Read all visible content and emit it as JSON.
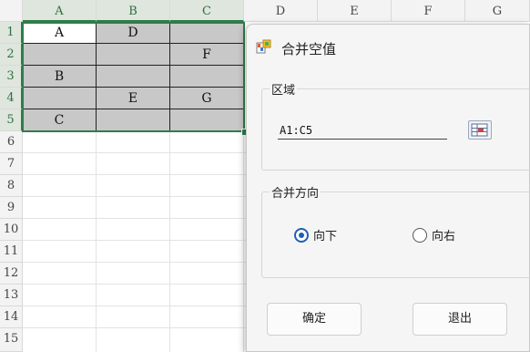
{
  "sheet": {
    "columns": [
      "A",
      "B",
      "C",
      "D",
      "E",
      "F",
      "G"
    ],
    "rows": [
      "1",
      "2",
      "3",
      "4",
      "5",
      "6",
      "7",
      "8",
      "9",
      "10",
      "11",
      "12",
      "13",
      "14",
      "15"
    ],
    "cells": {
      "A1": "A",
      "B1": "D",
      "C1": "",
      "A2": "",
      "B2": "",
      "C2": "F",
      "A3": "B",
      "B3": "",
      "C3": "",
      "A4": "",
      "B4": "E",
      "C4": "G",
      "A5": "C",
      "B5": "",
      "C5": ""
    },
    "selected_range_color": "#2f7d4a",
    "empty_cell_color": "#c8c8c8"
  },
  "dialog": {
    "title": "合并空值",
    "icon": "merge-table-icon",
    "region": {
      "label": "区域",
      "value": "A1:C5",
      "picker_icon": "range-select-icon"
    },
    "direction": {
      "label": "合并方向",
      "options": [
        {
          "label": "向下",
          "selected": true
        },
        {
          "label": "向右",
          "selected": false
        }
      ]
    },
    "buttons": {
      "ok": "确定",
      "exit": "退出"
    },
    "accent_color": "#1f5fb4"
  }
}
